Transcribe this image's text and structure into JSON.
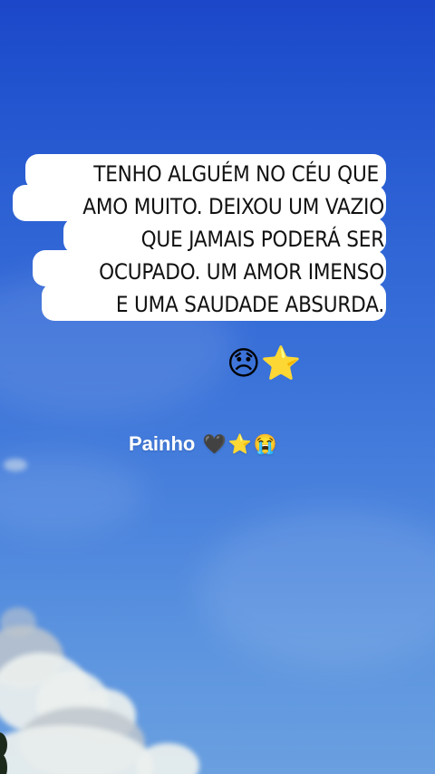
{
  "caption": {
    "lines": [
      "TENHO ALGUÉM NO CÉU QUE",
      "AMO MUITO. DEIXOU UM VAZIO",
      "QUE JAMAIS PODERÁ SER",
      "OCUPADO. UM AMOR IMENSO",
      "E UMA SAUDADE ABSURDA."
    ]
  },
  "emojis": {
    "sad_face": "😞",
    "star": "⭐"
  },
  "dedication": {
    "name": "Painho",
    "black_heart": "🖤",
    "star": "⭐",
    "crying_face": "😭"
  },
  "colors": {
    "sky_top": "#1b47c8",
    "sky_bottom": "#6aa0e0",
    "bubble": "#ffffff",
    "caption_text": "#111111",
    "dedication_text": "#ffffff"
  }
}
